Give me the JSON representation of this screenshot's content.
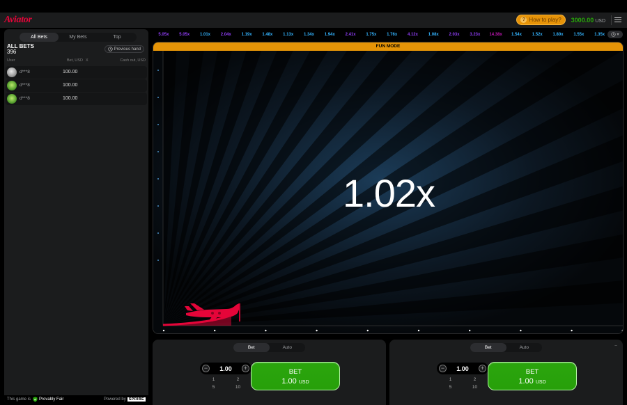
{
  "header": {
    "logo": "Aviator",
    "how_to_play": "How to play?",
    "balance": "3000.00",
    "currency": "USD"
  },
  "sidebar": {
    "tabs": [
      "All Bets",
      "My Bets",
      "Top"
    ],
    "active_tab": "All Bets",
    "title": "ALL BETS",
    "count": "396",
    "previous_hand": "Previous hand",
    "columns": {
      "user": "User",
      "bet": "Bet, USD",
      "x": "X",
      "cashout": "Cash out, USD"
    },
    "rows": [
      {
        "user": "d***8",
        "bet": "100.00"
      },
      {
        "user": "d***8",
        "bet": "100.00"
      },
      {
        "user": "d***8",
        "bet": "100.00"
      }
    ],
    "footer": {
      "this_game_is": "This game is",
      "provably_fair": "Provably Fair",
      "powered_by": "Powered by",
      "provider": "SPRIBE"
    }
  },
  "multipliers": [
    {
      "value": "5.05x",
      "color": "#913ef8"
    },
    {
      "value": "5.05x",
      "color": "#913ef8"
    },
    {
      "value": "1.01x",
      "color": "#34b4ff"
    },
    {
      "value": "2.04x",
      "color": "#913ef8"
    },
    {
      "value": "1.19x",
      "color": "#34b4ff"
    },
    {
      "value": "1.48x",
      "color": "#34b4ff"
    },
    {
      "value": "1.13x",
      "color": "#34b4ff"
    },
    {
      "value": "1.34x",
      "color": "#34b4ff"
    },
    {
      "value": "1.94x",
      "color": "#34b4ff"
    },
    {
      "value": "2.41x",
      "color": "#913ef8"
    },
    {
      "value": "1.75x",
      "color": "#34b4ff"
    },
    {
      "value": "1.76x",
      "color": "#34b4ff"
    },
    {
      "value": "4.12x",
      "color": "#913ef8"
    },
    {
      "value": "1.08x",
      "color": "#34b4ff"
    },
    {
      "value": "2.03x",
      "color": "#913ef8"
    },
    {
      "value": "3.23x",
      "color": "#913ef8"
    },
    {
      "value": "14.38x",
      "color": "#c017b4"
    },
    {
      "value": "1.54x",
      "color": "#34b4ff"
    },
    {
      "value": "1.52x",
      "color": "#34b4ff"
    },
    {
      "value": "1.80x",
      "color": "#34b4ff"
    },
    {
      "value": "1.55x",
      "color": "#34b4ff"
    },
    {
      "value": "1.35x",
      "color": "#34b4ff"
    }
  ],
  "game": {
    "fun_mode": "FUN MODE",
    "multiplier": "1.02x"
  },
  "bet_panels": [
    {
      "tabs": [
        "Bet",
        "Auto"
      ],
      "active_tab": "Bet",
      "amount": "1.00",
      "quick": [
        "1",
        "2",
        "5",
        "10"
      ],
      "button_title": "BET",
      "button_amount": "1.00",
      "button_currency": "USD"
    },
    {
      "tabs": [
        "Bet",
        "Auto"
      ],
      "active_tab": "Bet",
      "amount": "1.00",
      "quick": [
        "1",
        "2",
        "5",
        "10"
      ],
      "button_title": "BET",
      "button_amount": "1.00",
      "button_currency": "USD"
    }
  ],
  "colors": {
    "brand": "#e50539",
    "accent": "#e59407",
    "bet_green": "#28a909",
    "balance_green": "#28a909"
  }
}
